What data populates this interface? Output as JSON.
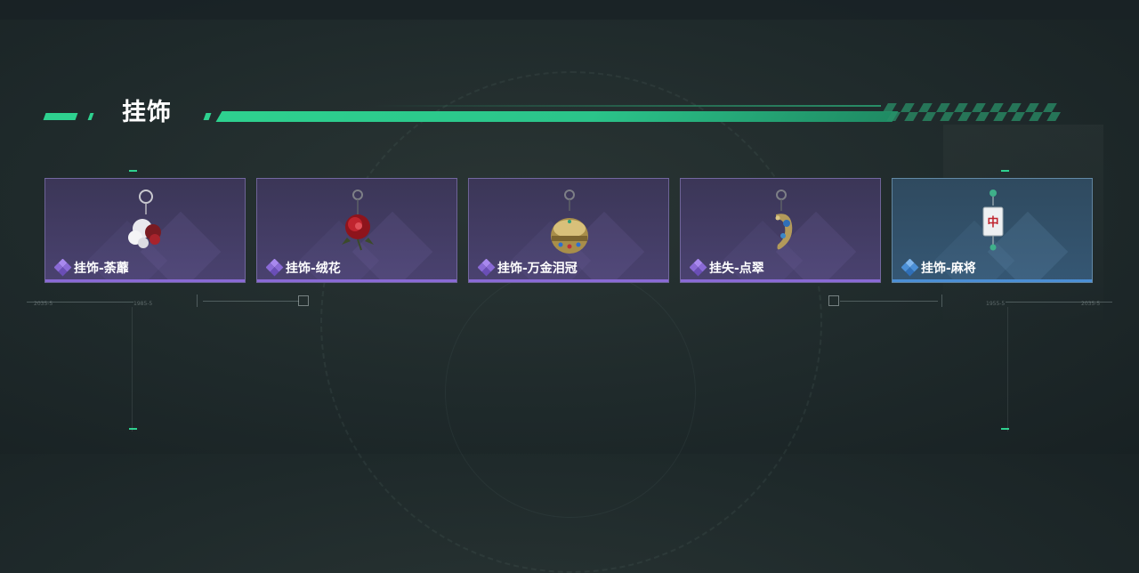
{
  "section": {
    "title": "挂饰"
  },
  "items": [
    {
      "label": "挂饰-荼蘼",
      "rarity": "purple",
      "charm_icon": "white-flower-charm-icon"
    },
    {
      "label": "挂饰-绒花",
      "rarity": "purple",
      "charm_icon": "red-rose-charm-icon"
    },
    {
      "label": "挂饰-万金泪冠",
      "rarity": "purple",
      "charm_icon": "jeweled-crown-charm-icon"
    },
    {
      "label": "挂失-点翠",
      "rarity": "purple",
      "charm_icon": "kingfisher-hairpin-charm-icon"
    },
    {
      "label": "挂饰-麻将",
      "rarity": "blue",
      "charm_icon": "mahjong-tile-charm-icon"
    }
  ],
  "deco": {
    "tags": [
      "2035-5",
      "1985-5",
      "1955-5",
      "2035-5"
    ],
    "mahjong_glyph": "中"
  },
  "colors": {
    "accent": "#2ed18f",
    "purple_rarity": "#8a6ad6",
    "blue_rarity": "#4b8fd6"
  }
}
